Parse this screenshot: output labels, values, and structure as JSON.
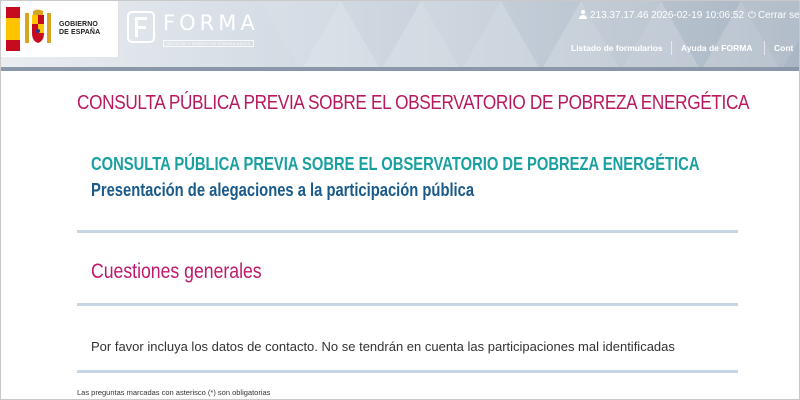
{
  "header": {
    "gov_logo_line1": "GOBIERNO",
    "gov_logo_line2": "DE ESPAÑA",
    "app_name": "FORMA",
    "app_subtitle": "GESTIÓN Y DISEÑO DE FORMULARIOS",
    "session_info": "213.37.17.46 2026-02-19 10:06:52",
    "logout_label": "Cerrar ses",
    "nav": [
      "Listado de formularios",
      "Ayuda de FORMA",
      "Cont"
    ]
  },
  "page": {
    "title": "CONSULTA PÚBLICA PREVIA SOBRE EL OBSERVATORIO DE POBREZA ENERGÉTICA"
  },
  "form": {
    "title": "CONSULTA PÚBLICA PREVIA SOBRE EL OBSERVATORIO DE POBREZA ENERGÉTICA",
    "subtitle": "Presentación de alegaciones a la participación pública",
    "section_title": "Cuestiones generales",
    "notice": "Por favor incluya los datos de contacto. No se tendrán en cuenta las participaciones mal identificadas",
    "required_note": "Las preguntas marcadas con asterisco (*) son obligatorias"
  },
  "colors": {
    "page_title": "#b8185e",
    "form_title": "#1aa0a0",
    "form_subtitle": "#1a5a8a",
    "section_title": "#c0186a",
    "divider": "#c5d5e3"
  },
  "icons": [
    "spain-coat-of-arms-icon",
    "forma-logo-icon",
    "user-icon",
    "power-icon"
  ]
}
